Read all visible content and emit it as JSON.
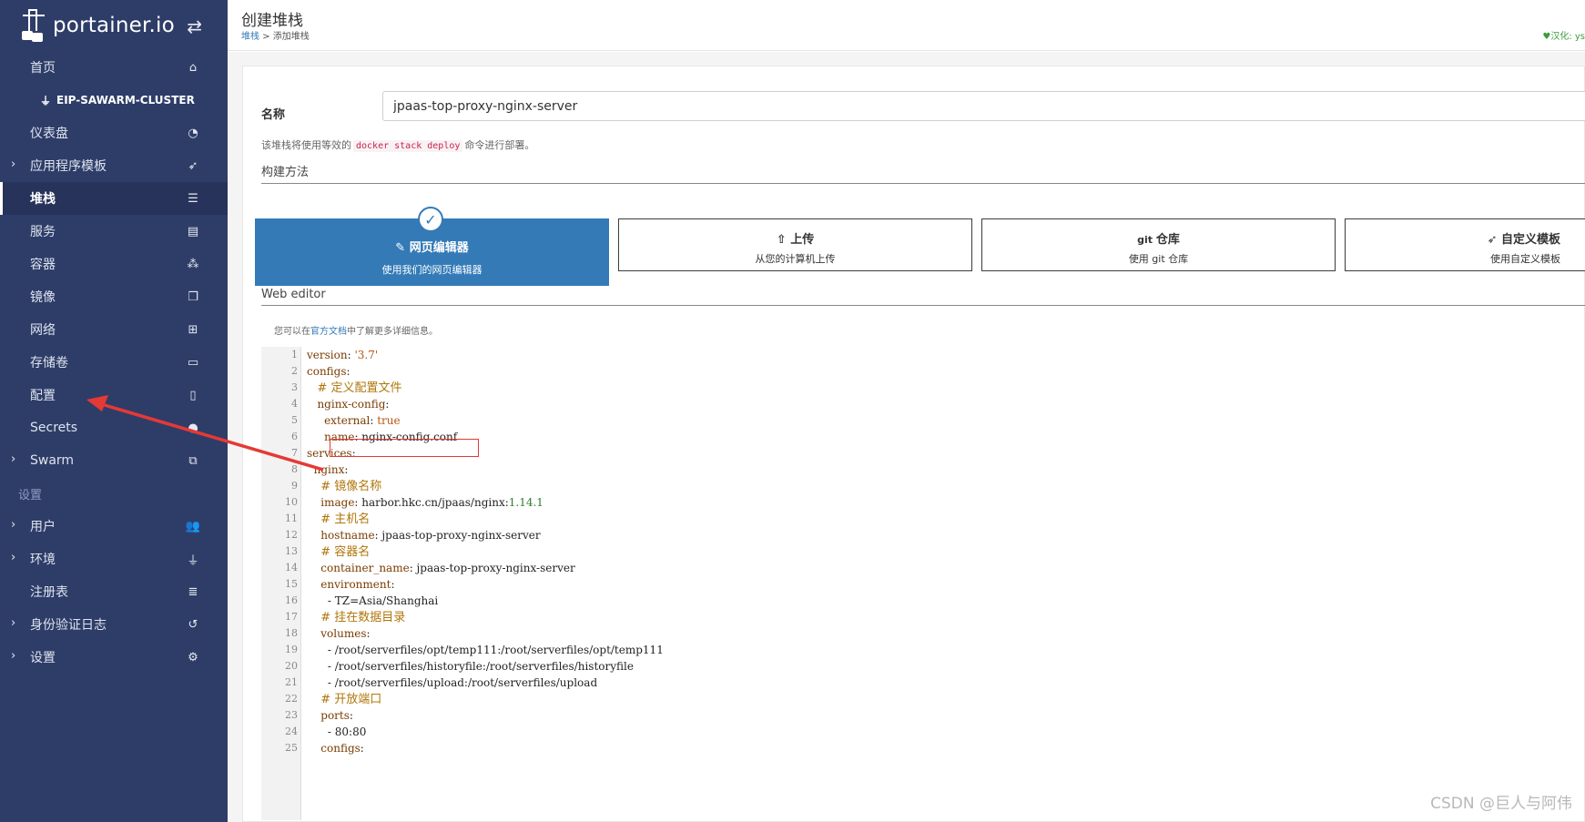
{
  "app": {
    "logo_text": "portainer.io"
  },
  "sidebar": {
    "items": [
      {
        "label": "首页",
        "icon": "home-icon"
      },
      {
        "label": "EIP-SAWARM-CLUSTER",
        "icon": "plug-icon"
      },
      {
        "label": "仪表盘",
        "icon": "tachometer-icon"
      },
      {
        "label": "应用程序模板",
        "icon": "rocket-icon"
      },
      {
        "label": "堆栈",
        "icon": "th-list-icon"
      },
      {
        "label": "服务",
        "icon": "list-alt-icon"
      },
      {
        "label": "容器",
        "icon": "cubes-icon"
      },
      {
        "label": "镜像",
        "icon": "clone-icon"
      },
      {
        "label": "网络",
        "icon": "sitemap-icon"
      },
      {
        "label": "存储卷",
        "icon": "hdd-icon"
      },
      {
        "label": "配置",
        "icon": "file-code-icon"
      },
      {
        "label": "Secrets",
        "icon": "user-secret-icon"
      },
      {
        "label": "Swarm",
        "icon": "object-group-icon"
      },
      {
        "label": "设置",
        "icon": ""
      },
      {
        "label": "用户",
        "icon": "users-icon"
      },
      {
        "label": "环境",
        "icon": "plug-icon"
      },
      {
        "label": "注册表",
        "icon": "database-icon"
      },
      {
        "label": "身份验证日志",
        "icon": "history-icon"
      },
      {
        "label": "设置",
        "icon": "cogs-icon"
      }
    ]
  },
  "header": {
    "title": "创建堆栈",
    "breadcrumb_link": "堆栈",
    "breadcrumb_sep": " > ",
    "breadcrumb_current": "添加堆栈",
    "locale_text": "♥汉化: ys"
  },
  "form": {
    "name_label": "名称",
    "name_value": "jpaas-top-proxy-nginx-server",
    "hint_prefix": "该堆栈将使用等效的",
    "hint_code": "docker stack deploy",
    "hint_suffix": "命令进行部署。",
    "build_method_title": "构建方法",
    "methods": [
      {
        "title": "网页编辑器",
        "subtitle": "使用我们的网页编辑器",
        "icon": "edit-icon",
        "selected": true
      },
      {
        "title": "上传",
        "subtitle": "从您的计算机上传",
        "icon": "upload-icon",
        "selected": false
      },
      {
        "title": "仓库",
        "subtitle": "使用 git 仓库",
        "icon": "git-icon",
        "selected": false
      },
      {
        "title": "自定义模板",
        "subtitle": "使用自定义模板",
        "icon": "rocket-icon",
        "selected": false
      }
    ],
    "web_editor_title": "Web editor",
    "docs_prefix": "您可以在",
    "docs_link": "官方文档",
    "docs_suffix": "中了解更多详细信息。"
  },
  "editor": {
    "lines": [
      "version: '3.7'",
      "configs:",
      "   # 定义配置文件",
      "   nginx-config:",
      "     external: true",
      "     name: nginx-config.conf",
      "services:",
      "  nginx:",
      "    # 镜像名称",
      "    image: harbor.hkc.cn/jpaas/nginx:1.14.1",
      "    # 主机名",
      "    hostname: jpaas-top-proxy-nginx-server",
      "    # 容器名",
      "    container_name: jpaas-top-proxy-nginx-server",
      "    environment:",
      "      - TZ=Asia/Shanghai",
      "    # 挂在数据目录",
      "    volumes:",
      "      - /root/serverfiles/opt/temp111:/root/serverfiles/opt/temp111",
      "      - /root/serverfiles/historyfile:/root/serverfiles/historyfile",
      "      - /root/serverfiles/upload:/root/serverfiles/upload",
      "    # 开放端口",
      "    ports:",
      "      - 80:80",
      "    configs:"
    ]
  },
  "watermark": "CSDN @巨人与阿伟",
  "colors": {
    "sidebar_bg": "#2e3d68",
    "primary": "#337ab7",
    "annotation_red": "#e53935"
  }
}
